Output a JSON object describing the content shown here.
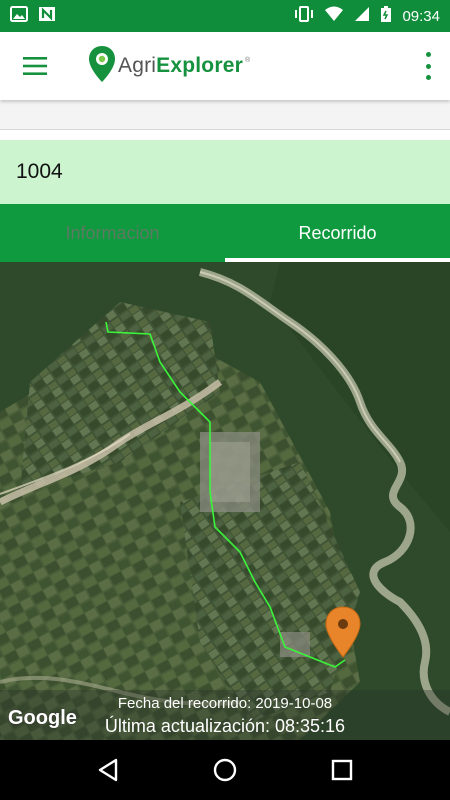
{
  "status_bar": {
    "time": "09:34",
    "left_icons": [
      "image-icon",
      "n-notification-icon"
    ],
    "right_icons": [
      "vibrate-icon",
      "wifi-icon",
      "signal-icon",
      "battery-icon"
    ]
  },
  "app_bar": {
    "logo_prefix": "Agri",
    "logo_bold": "Explorer",
    "logo_tm": "®",
    "menu_icon": "hamburger-menu-icon",
    "more_icon": "more-vert-icon",
    "accent_color": "#16923f"
  },
  "record": {
    "id": "1004"
  },
  "tabs": [
    {
      "label": "Informacion",
      "active": false
    },
    {
      "label": "Recorrido",
      "active": true
    }
  ],
  "map": {
    "attribution": "Google",
    "date_label": "Fecha del recorrido: 2019-10-08",
    "update_label": "Última actualización: 08:35:16",
    "marker_color": "#e8852a",
    "route_color": "#3bf53b"
  },
  "nav_bar": {
    "buttons": [
      "back-icon",
      "home-icon",
      "recents-icon"
    ]
  }
}
